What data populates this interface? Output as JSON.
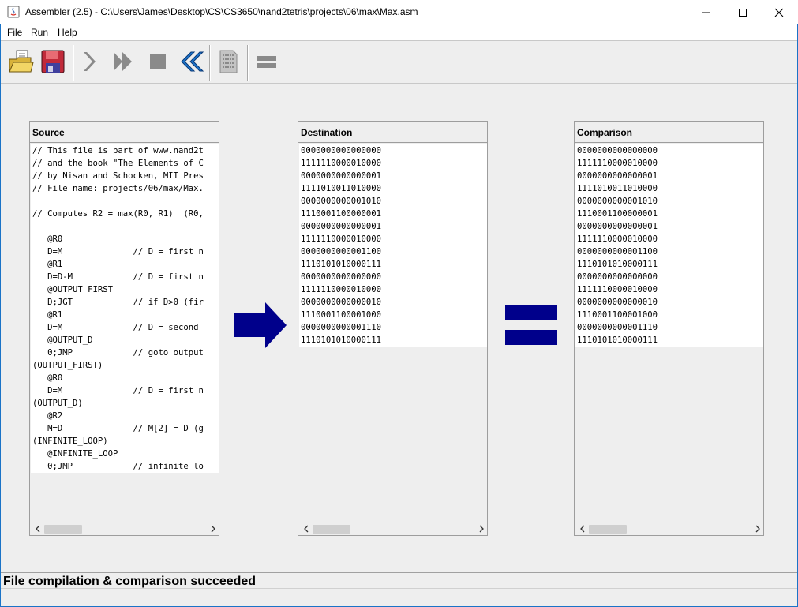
{
  "window": {
    "title": "Assembler (2.5) - C:\\Users\\James\\Desktop\\CS\\CS3650\\nand2tetris\\projects\\06\\max\\Max.asm",
    "icon": "java-icon"
  },
  "menu": [
    "File",
    "Run",
    "Help"
  ],
  "toolbar": [
    "open-folder-icon",
    "save-icon",
    "single-step-icon",
    "fast-forward-icon",
    "stop-icon",
    "rewind-icon",
    "binary-file-icon",
    "equal-icon"
  ],
  "panels": {
    "source": {
      "title": "Source",
      "lines": [
        "// This file is part of www.nand2t",
        "// and the book \"The Elements of C",
        "// by Nisan and Schocken, MIT Pres",
        "// File name: projects/06/max/Max.",
        "",
        "// Computes R2 = max(R0, R1)  (R0,",
        "",
        "   @R0",
        "   D=M              // D = first n",
        "   @R1",
        "   D=D-M            // D = first n",
        "   @OUTPUT_FIRST",
        "   D;JGT            // if D>0 (fir",
        "   @R1",
        "   D=M              // D = second",
        "   @OUTPUT_D",
        "   0;JMP            // goto output",
        "(OUTPUT_FIRST)",
        "   @R0",
        "   D=M              // D = first n",
        "(OUTPUT_D)",
        "   @R2",
        "   M=D              // M[2] = D (g",
        "(INFINITE_LOOP)",
        "   @INFINITE_LOOP",
        "   0;JMP            // infinite lo"
      ]
    },
    "destination": {
      "title": "Destination",
      "lines": [
        "0000000000000000",
        "1111110000010000",
        "0000000000000001",
        "1111010011010000",
        "0000000000001010",
        "1110001100000001",
        "0000000000000001",
        "1111110000010000",
        "0000000000001100",
        "1110101010000111",
        "0000000000000000",
        "1111110000010000",
        "0000000000000010",
        "1110001100001000",
        "0000000000001110",
        "1110101010000111"
      ]
    },
    "comparison": {
      "title": "Comparison",
      "lines": [
        "0000000000000000",
        "1111110000010000",
        "0000000000000001",
        "1111010011010000",
        "0000000000001010",
        "1110001100000001",
        "0000000000000001",
        "1111110000010000",
        "0000000000001100",
        "1110101010000111",
        "0000000000000000",
        "1111110000010000",
        "0000000000000010",
        "1110001100001000",
        "0000000000001110",
        "1110101010000111"
      ]
    }
  },
  "status": {
    "message": "File compilation & comparison succeeded"
  },
  "colors": {
    "indicator": "#00008b",
    "toolbar_disabled": "#8a8a8a"
  }
}
